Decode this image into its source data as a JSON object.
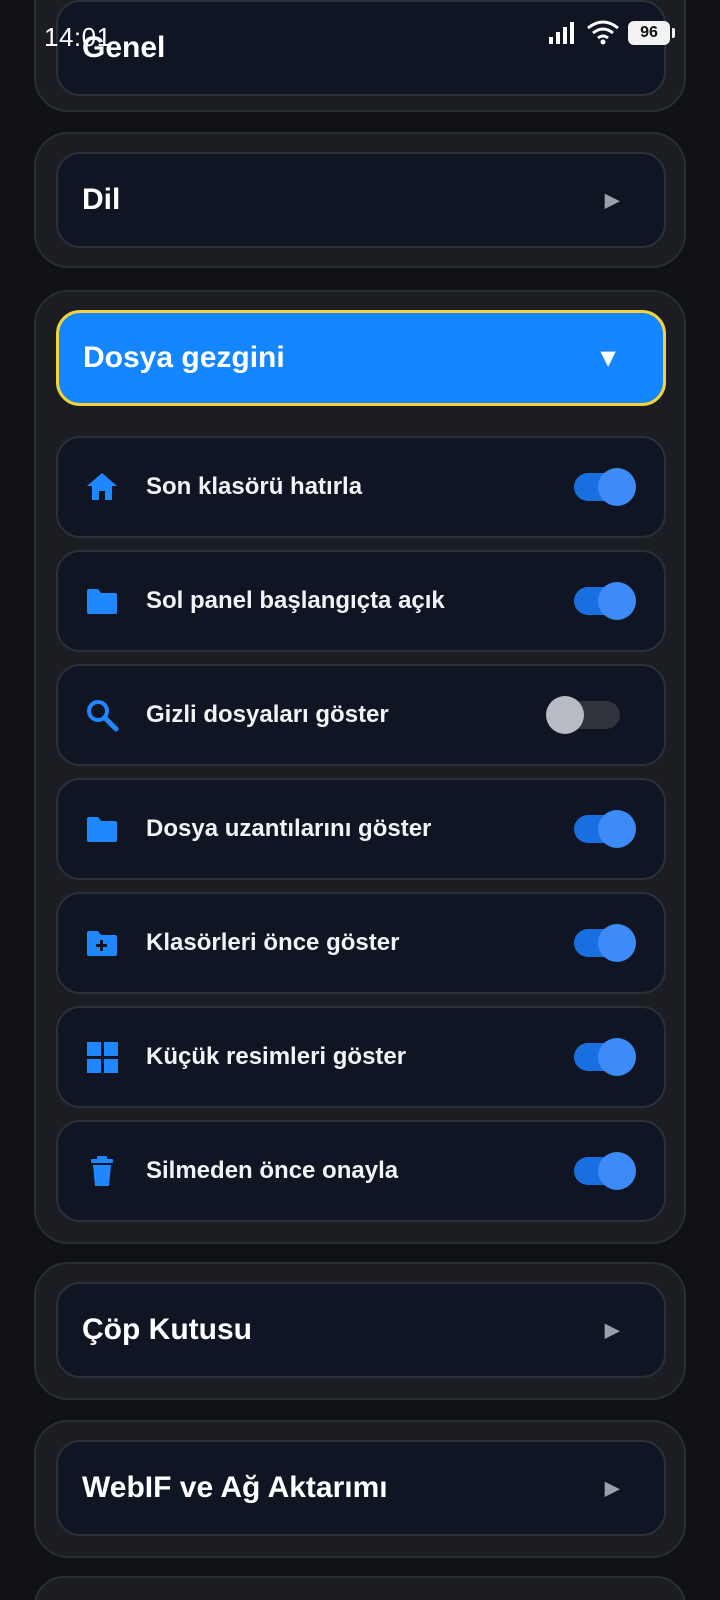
{
  "status_bar": {
    "time": "14:01",
    "battery": "96"
  },
  "groups": {
    "genel": {
      "title": "Genel"
    },
    "dil": {
      "title": "Dil"
    },
    "dosya_gezgini": {
      "title": "Dosya gezgini",
      "items": [
        {
          "label": "Son klasörü hatırla",
          "icon": "home-icon",
          "on": true
        },
        {
          "label": "Sol panel başlangıçta açık",
          "icon": "folder-icon",
          "on": true
        },
        {
          "label": "Gizli dosyaları göster",
          "icon": "search-icon",
          "on": false
        },
        {
          "label": "Dosya uzantılarını göster",
          "icon": "folder-icon",
          "on": true
        },
        {
          "label": "Klasörleri önce göster",
          "icon": "folder-plus-icon",
          "on": true
        },
        {
          "label": "Küçük resimleri göster",
          "icon": "grid-icon",
          "on": true
        },
        {
          "label": "Silmeden önce onayla",
          "icon": "trash-icon",
          "on": true
        }
      ]
    },
    "cop_kutusu": {
      "title": "Çöp Kutusu"
    },
    "webif": {
      "title": "WebIF ve Ağ Aktarımı"
    }
  },
  "glyphs": {
    "collapsed": "▶",
    "expanded": "▼"
  },
  "colors": {
    "accent": "#1486ff",
    "focus_border": "#f4d33a",
    "toggle_on": "#3d8bf7"
  }
}
